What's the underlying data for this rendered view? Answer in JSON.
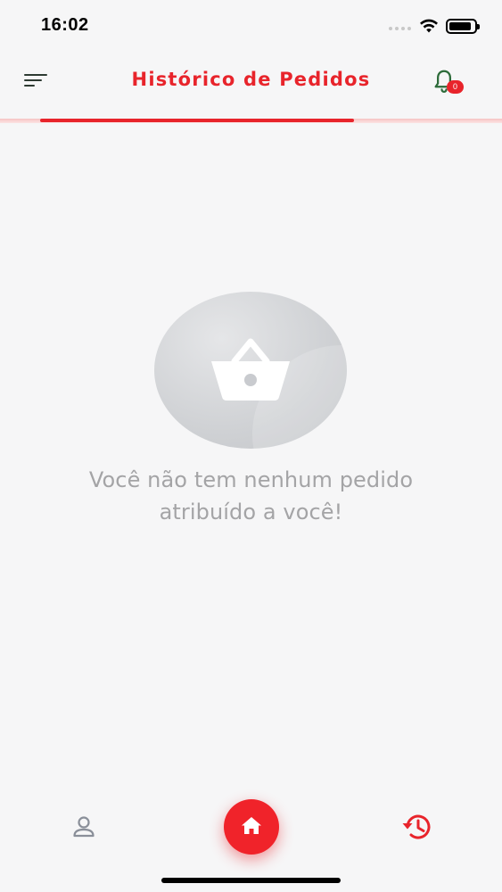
{
  "status_bar": {
    "time": "16:02"
  },
  "header": {
    "title": "Histórico de Pedidos",
    "notification_count": "0",
    "accent_color": "#e8242b"
  },
  "empty_state": {
    "icon": "basket-icon",
    "message_line1": "Você não tem nenhum pedido",
    "message_line2": "atribuído a você!"
  },
  "bottom_nav": {
    "items": [
      {
        "name": "profile",
        "icon": "user-icon"
      },
      {
        "name": "home",
        "icon": "home-icon",
        "active": true
      },
      {
        "name": "history",
        "icon": "history-icon"
      }
    ]
  }
}
